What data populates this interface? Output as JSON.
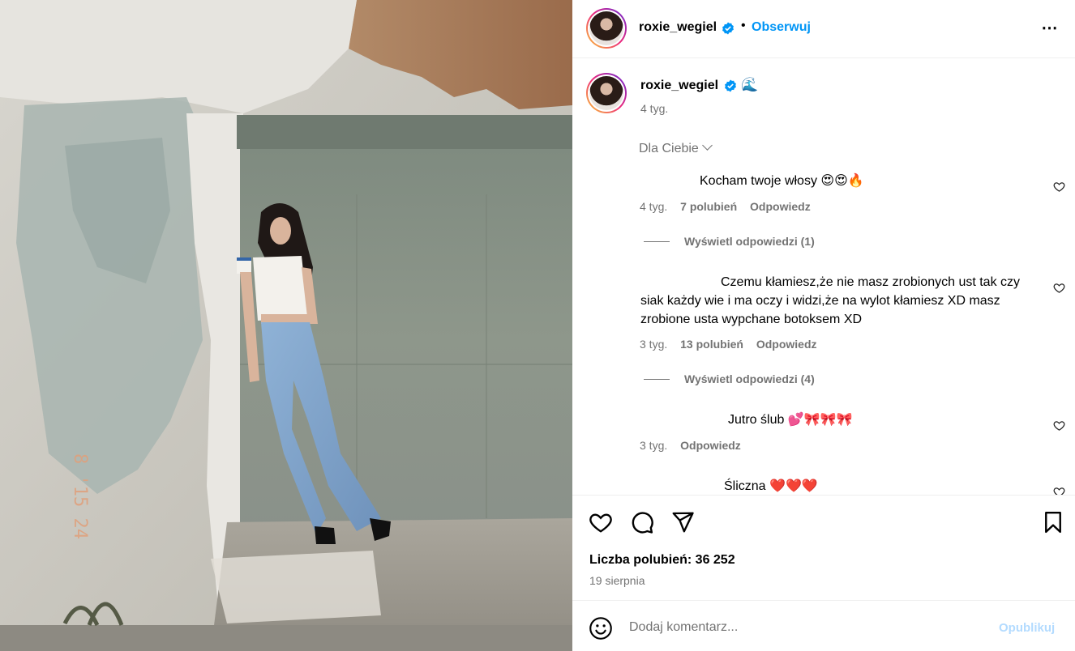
{
  "header": {
    "username": "roxie_wegiel",
    "dot": "•",
    "follow_label": "Obserwuj",
    "more_label": "⋯"
  },
  "caption": {
    "username": "roxie_wegiel",
    "emoji": "🌊",
    "time": "4 tyg."
  },
  "sort": {
    "label": "Dla Ciebie"
  },
  "comments": [
    {
      "text": "Kocham twoje włosy 😍😍🔥",
      "time": "4 tyg.",
      "likes": "7 polubień",
      "reply": "Odpowiedz",
      "view_replies": "Wyświetl odpowiedzi (1)"
    },
    {
      "text": "Czemu kłamiesz,że nie masz zrobionych ust tak czy siak każdy wie i ma oczy i widzi,że na wylot kłamiesz XD masz zrobione usta wypchane botoksem XD",
      "time": "3 tyg.",
      "likes": "13 polubień",
      "reply": "Odpowiedz",
      "view_replies": "Wyświetl odpowiedzi (4)"
    },
    {
      "text": "Jutro ślub 💕🎀🎀🎀",
      "time": "3 tyg.",
      "reply": "Odpowiedz"
    },
    {
      "text": "Śliczna ❤️❤️❤️"
    }
  ],
  "likes": "Liczba polubień: 36 252",
  "date": "19 sierpnia",
  "composer": {
    "placeholder": "Dodaj komentarz...",
    "publish_label": "Opublikuj"
  },
  "colors": {
    "accent": "#0095f6",
    "muted": "#737373",
    "publish_disabled": "#b3dbff"
  },
  "icons": [
    "verified-badge-icon",
    "more-options-icon",
    "chevron-down-icon",
    "heart-icon",
    "comment-icon",
    "share-icon",
    "bookmark-icon",
    "emoji-icon"
  ]
}
